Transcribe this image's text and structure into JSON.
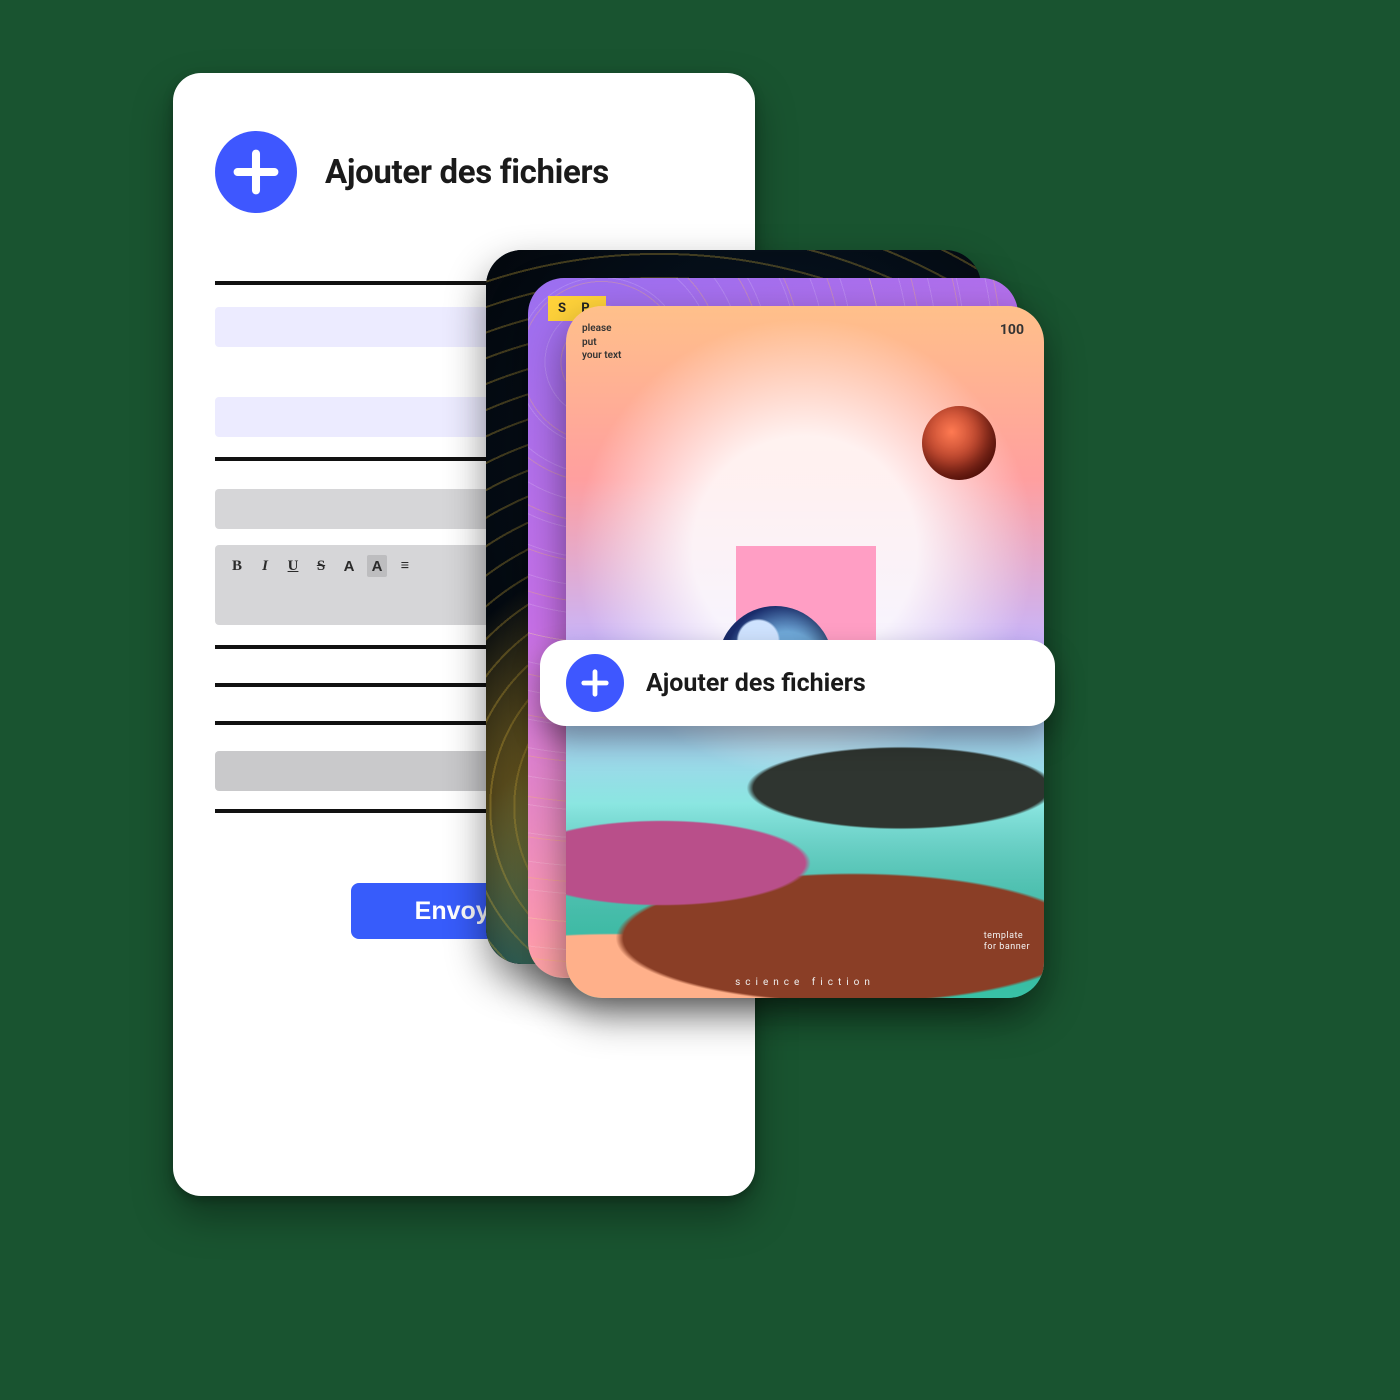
{
  "card": {
    "add_label": "Ajouter des fichiers",
    "send_label": "Envoyer",
    "toolbar": {
      "bold": "B",
      "italic": "I",
      "underline": "U",
      "strike": "S",
      "font": "A",
      "highlight": "A",
      "list": "≡"
    }
  },
  "pill": {
    "label": "Ajouter des fichiers"
  },
  "stack": {
    "b_tag": "S P",
    "c_corner_l1": "please",
    "c_corner_l2": "put",
    "c_corner_l3": "your text",
    "c_num": "100",
    "c_tmpl_l1": "template",
    "c_tmpl_l2": "for banner",
    "c_footer": "science fiction"
  },
  "colors": {
    "blue": "#3E57FF",
    "lavender": "#ECEBFF"
  }
}
